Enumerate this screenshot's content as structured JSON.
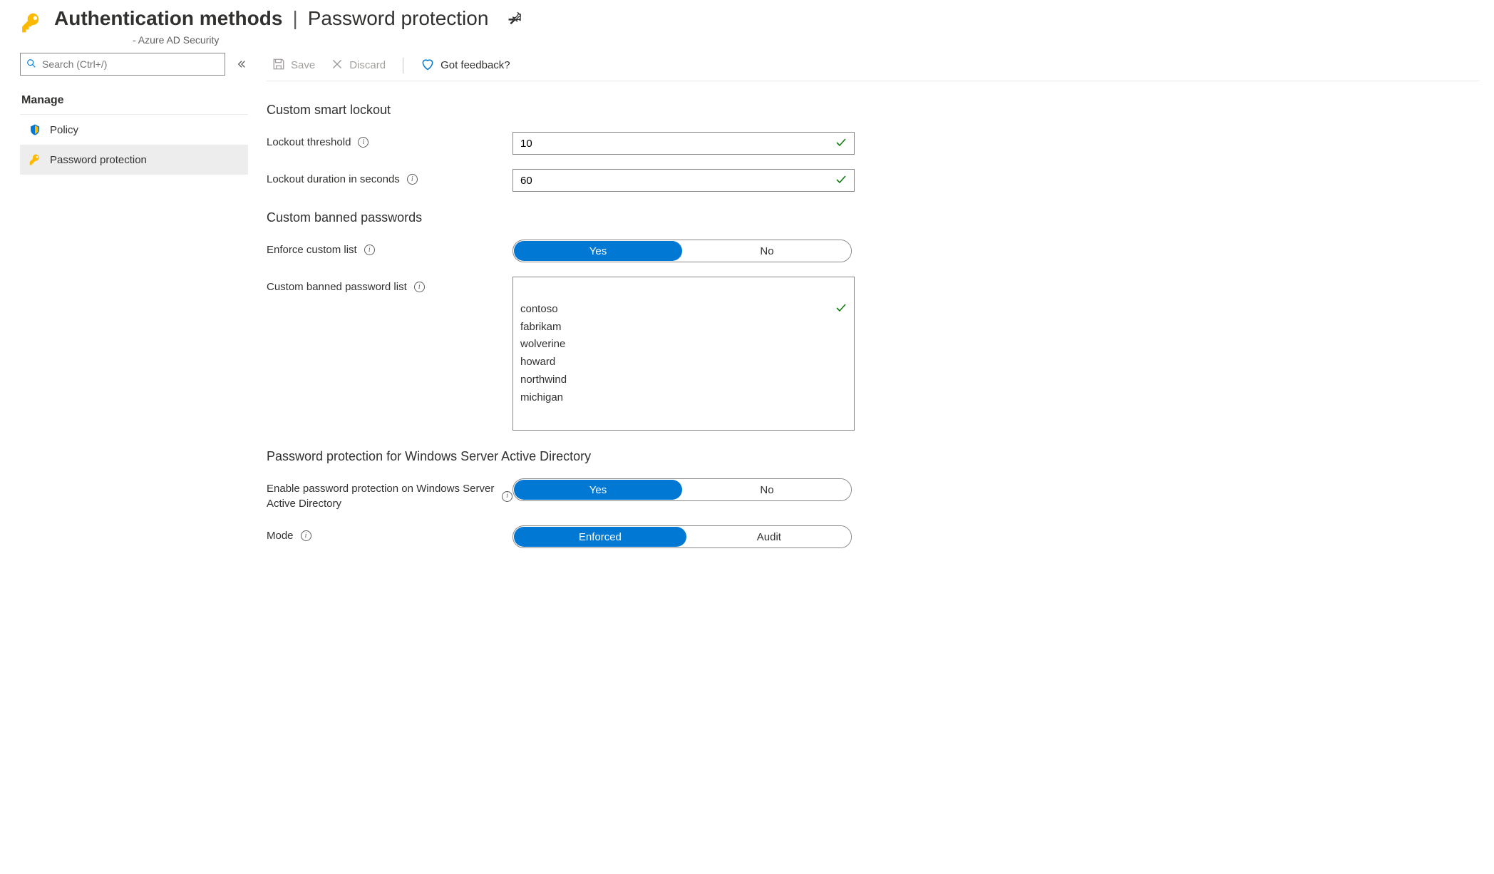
{
  "header": {
    "title_bold": "Authentication methods",
    "title_sep": "|",
    "title_rest": "Password protection",
    "subtitle": "- Azure AD Security"
  },
  "sidebar": {
    "search_placeholder": "Search (Ctrl+/)",
    "section_label": "Manage",
    "items": [
      {
        "label": "Policy",
        "icon": "policy",
        "selected": false
      },
      {
        "label": "Password protection",
        "icon": "key",
        "selected": true
      }
    ]
  },
  "toolbar": {
    "save_label": "Save",
    "discard_label": "Discard",
    "feedback_label": "Got feedback?"
  },
  "form": {
    "section1": "Custom smart lockout",
    "lockout_threshold_label": "Lockout threshold",
    "lockout_threshold_value": "10",
    "lockout_duration_label": "Lockout duration in seconds",
    "lockout_duration_value": "60",
    "section2": "Custom banned passwords",
    "enforce_label": "Enforce custom list",
    "enforce_options": {
      "yes": "Yes",
      "no": "No"
    },
    "enforce_selected": "Yes",
    "banned_list_label": "Custom banned password list",
    "banned_list_value": "contoso\nfabrikam\nwolverine\nhoward\nnorthwind\nmichigan",
    "section3": "Password protection for Windows Server Active Directory",
    "enable_ws_label": "Enable password protection on Windows Server Active Directory",
    "enable_ws_options": {
      "yes": "Yes",
      "no": "No"
    },
    "enable_ws_selected": "Yes",
    "mode_label": "Mode",
    "mode_options": {
      "enforced": "Enforced",
      "audit": "Audit"
    },
    "mode_selected": "Enforced"
  }
}
